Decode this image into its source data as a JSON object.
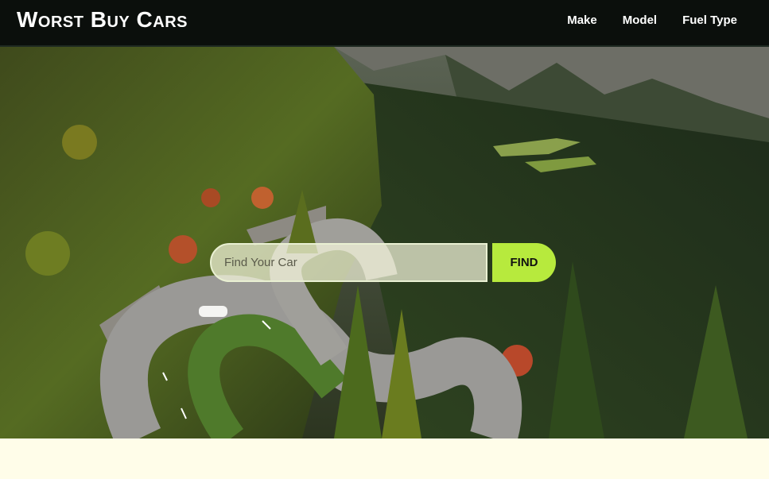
{
  "brand": {
    "name": "Worst Buy Cars"
  },
  "nav": {
    "items": [
      "Make",
      "Model",
      "Fuel Type"
    ]
  },
  "search": {
    "placeholder": "Find Your Car",
    "button_label": "FIND"
  },
  "colors": {
    "header_bg": "#0b0f0c",
    "accent": "#b7ea3d",
    "page_bg": "#fffde9"
  },
  "hero": {
    "image_description_icon": "mountain-road-photo"
  }
}
